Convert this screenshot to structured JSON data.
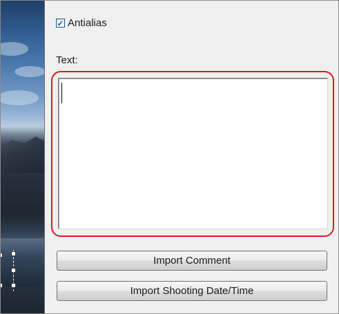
{
  "antialias": {
    "label": "Antialias",
    "checked": true
  },
  "text_field": {
    "label": "Text:",
    "value": ""
  },
  "buttons": {
    "import_comment": "Import Comment",
    "import_shooting_datetime": "Import Shooting Date/Time"
  },
  "colors": {
    "highlight": "#e4141b",
    "panel_background": "#f0f0f0"
  }
}
